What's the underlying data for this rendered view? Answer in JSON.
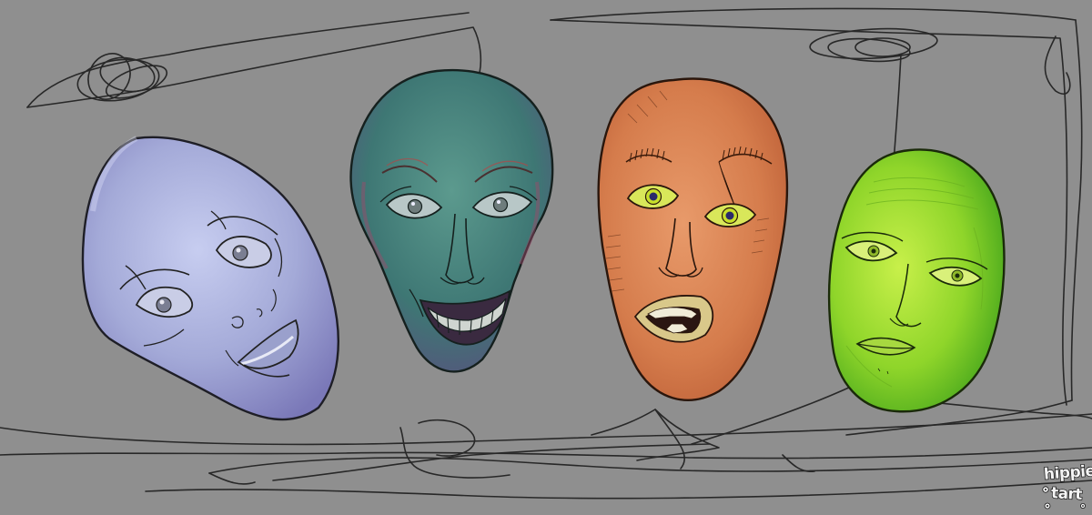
{
  "background_color": "#8f8f8f",
  "signature": {
    "line1": "hippie",
    "line2": "tart"
  },
  "masks": [
    {
      "name": "lavender-mask",
      "color": "#a5acd8",
      "expression": "sad"
    },
    {
      "name": "teal-mask",
      "color": "#3f7a78",
      "expression": "grinning"
    },
    {
      "name": "orange-mask",
      "color": "#d98150",
      "expression": "shocked"
    },
    {
      "name": "green-mask",
      "color": "#8fd52a",
      "expression": "weary"
    }
  ]
}
